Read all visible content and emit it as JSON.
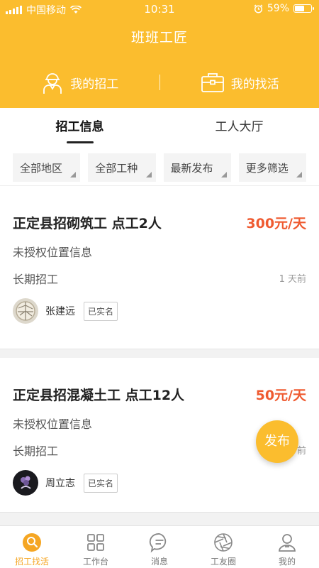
{
  "status_bar": {
    "carrier": "中国移动",
    "time": "10:31",
    "battery": "59%",
    "battery_level": 0.59
  },
  "header": {
    "title": "班班工匠",
    "actions": [
      {
        "label": "我的招工",
        "icon": "worker-icon"
      },
      {
        "label": "我的找活",
        "icon": "briefcase-icon"
      }
    ]
  },
  "tabs": [
    {
      "label": "招工信息",
      "active": true
    },
    {
      "label": "工人大厅",
      "active": false
    }
  ],
  "filters": [
    "全部地区",
    "全部工种",
    "最新发布",
    "更多筛选"
  ],
  "jobs": [
    {
      "title": "正定县招砌筑工 点工2人",
      "price": "300元/天",
      "location": "未授权位置信息",
      "term": "长期招工",
      "time": "1 天前",
      "user": "张建远",
      "verified": "已实名"
    },
    {
      "title": "正定县招混凝土工 点工12人",
      "price": "50元/天",
      "location": "未授权位置信息",
      "term": "长期招工",
      "time": "前",
      "user": "周立志",
      "verified": "已实名"
    }
  ],
  "fab": {
    "label": "发布"
  },
  "bottom_nav": [
    {
      "label": "招工找活",
      "icon": "search-person-icon",
      "active": true
    },
    {
      "label": "工作台",
      "icon": "grid-icon",
      "active": false
    },
    {
      "label": "消息",
      "icon": "message-icon",
      "active": false
    },
    {
      "label": "工友圈",
      "icon": "aperture-icon",
      "active": false
    },
    {
      "label": "我的",
      "icon": "profile-icon",
      "active": false
    }
  ],
  "colors": {
    "brand": "#fbbd2e",
    "price": "#ef5a30",
    "nav_active": "#f5a623"
  }
}
